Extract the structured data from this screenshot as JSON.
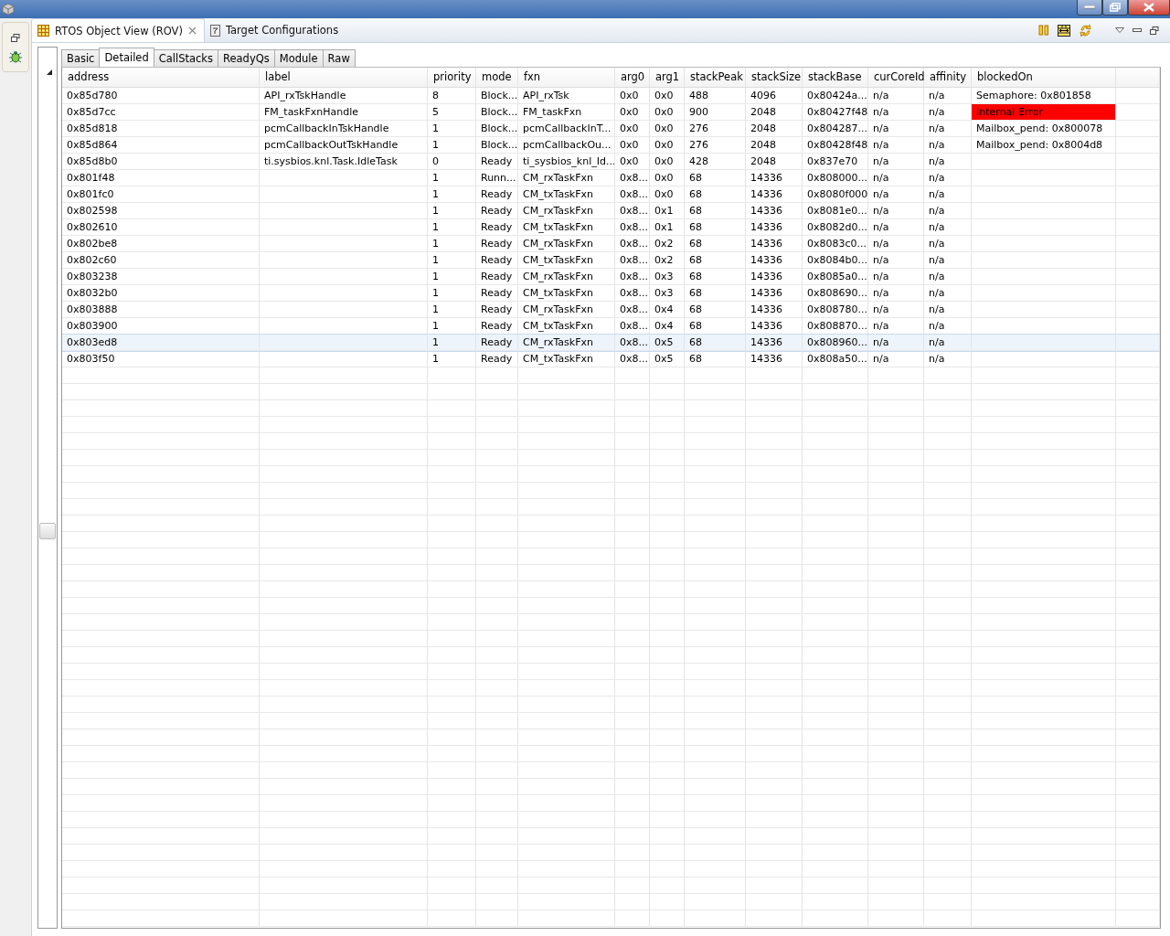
{
  "view_tabs": [
    {
      "label": "RTOS Object View (ROV)",
      "selected": true,
      "closable": true
    },
    {
      "label": "Target Configurations",
      "selected": false,
      "closable": false
    }
  ],
  "inner_tabs": [
    {
      "label": "Basic",
      "selected": false
    },
    {
      "label": "Detailed",
      "selected": true
    },
    {
      "label": "CallStacks",
      "selected": false
    },
    {
      "label": "ReadyQs",
      "selected": false
    },
    {
      "label": "Module",
      "selected": false
    },
    {
      "label": "Raw",
      "selected": false
    }
  ],
  "table": {
    "columns": [
      "address",
      "label",
      "priority",
      "mode",
      "fxn",
      "arg0",
      "arg1",
      "stackPeak",
      "stackSize",
      "stackBase",
      "curCoreId",
      "affinity",
      "blockedOn"
    ],
    "rows": [
      {
        "address": "0x85d780",
        "label": "API_rxTskHandle",
        "priority": "8",
        "mode": "Block...",
        "fxn": "API_rxTsk",
        "arg0": "0x0",
        "arg1": "0x0",
        "stackPeak": "488",
        "stackSize": "4096",
        "stackBase": "0x80424a...",
        "curCoreId": "n/a",
        "affinity": "n/a",
        "blockedOn": "Semaphore: 0x801858",
        "error": false,
        "selected": false
      },
      {
        "address": "0x85d7cc",
        "label": "FM_taskFxnHandle",
        "priority": "5",
        "mode": "Block...",
        "fxn": "FM_taskFxn",
        "arg0": "0x0",
        "arg1": "0x0",
        "stackPeak": "900",
        "stackSize": "2048",
        "stackBase": "0x80427f48",
        "curCoreId": "n/a",
        "affinity": "n/a",
        "blockedOn": "Internal Error",
        "error": true,
        "selected": false
      },
      {
        "address": "0x85d818",
        "label": "pcmCallbackInTskHandle",
        "priority": "1",
        "mode": "Block...",
        "fxn": "pcmCallbackInT...",
        "arg0": "0x0",
        "arg1": "0x0",
        "stackPeak": "276",
        "stackSize": "2048",
        "stackBase": "0x804287...",
        "curCoreId": "n/a",
        "affinity": "n/a",
        "blockedOn": "Mailbox_pend: 0x800078",
        "error": false,
        "selected": false
      },
      {
        "address": "0x85d864",
        "label": "pcmCallbackOutTskHandle",
        "priority": "1",
        "mode": "Block...",
        "fxn": "pcmCallbackOu...",
        "arg0": "0x0",
        "arg1": "0x0",
        "stackPeak": "276",
        "stackSize": "2048",
        "stackBase": "0x80428f48",
        "curCoreId": "n/a",
        "affinity": "n/a",
        "blockedOn": "Mailbox_pend: 0x8004d8",
        "error": false,
        "selected": false
      },
      {
        "address": "0x85d8b0",
        "label": "ti.sysbios.knl.Task.IdleTask",
        "priority": "0",
        "mode": "Ready",
        "fxn": "ti_sysbios_knl_Id...",
        "arg0": "0x0",
        "arg1": "0x0",
        "stackPeak": "428",
        "stackSize": "2048",
        "stackBase": "0x837e70",
        "curCoreId": "n/a",
        "affinity": "n/a",
        "selected": false
      },
      {
        "address": "0x801f48",
        "priority": "1",
        "mode": "Runn...",
        "fxn": "CM_rxTaskFxn",
        "arg0": "0x8...",
        "arg1": "0x0",
        "stackPeak": "68",
        "stackSize": "14336",
        "stackBase": "0x808000...",
        "curCoreId": "n/a",
        "affinity": "n/a",
        "selected": false
      },
      {
        "address": "0x801fc0",
        "priority": "1",
        "mode": "Ready",
        "fxn": "CM_txTaskFxn",
        "arg0": "0x8...",
        "arg1": "0x0",
        "stackPeak": "68",
        "stackSize": "14336",
        "stackBase": "0x8080f000",
        "curCoreId": "n/a",
        "affinity": "n/a",
        "selected": false
      },
      {
        "address": "0x802598",
        "priority": "1",
        "mode": "Ready",
        "fxn": "CM_rxTaskFxn",
        "arg0": "0x8...",
        "arg1": "0x1",
        "stackPeak": "68",
        "stackSize": "14336",
        "stackBase": "0x8081e0...",
        "curCoreId": "n/a",
        "affinity": "n/a",
        "selected": false
      },
      {
        "address": "0x802610",
        "priority": "1",
        "mode": "Ready",
        "fxn": "CM_txTaskFxn",
        "arg0": "0x8...",
        "arg1": "0x1",
        "stackPeak": "68",
        "stackSize": "14336",
        "stackBase": "0x8082d0...",
        "curCoreId": "n/a",
        "affinity": "n/a",
        "selected": false
      },
      {
        "address": "0x802be8",
        "priority": "1",
        "mode": "Ready",
        "fxn": "CM_rxTaskFxn",
        "arg0": "0x8...",
        "arg1": "0x2",
        "stackPeak": "68",
        "stackSize": "14336",
        "stackBase": "0x8083c0...",
        "curCoreId": "n/a",
        "affinity": "n/a",
        "selected": false
      },
      {
        "address": "0x802c60",
        "priority": "1",
        "mode": "Ready",
        "fxn": "CM_txTaskFxn",
        "arg0": "0x8...",
        "arg1": "0x2",
        "stackPeak": "68",
        "stackSize": "14336",
        "stackBase": "0x8084b0...",
        "curCoreId": "n/a",
        "affinity": "n/a",
        "selected": false
      },
      {
        "address": "0x803238",
        "priority": "1",
        "mode": "Ready",
        "fxn": "CM_rxTaskFxn",
        "arg0": "0x8...",
        "arg1": "0x3",
        "stackPeak": "68",
        "stackSize": "14336",
        "stackBase": "0x8085a0...",
        "curCoreId": "n/a",
        "affinity": "n/a",
        "selected": false
      },
      {
        "address": "0x8032b0",
        "priority": "1",
        "mode": "Ready",
        "fxn": "CM_txTaskFxn",
        "arg0": "0x8...",
        "arg1": "0x3",
        "stackPeak": "68",
        "stackSize": "14336",
        "stackBase": "0x808690...",
        "curCoreId": "n/a",
        "affinity": "n/a",
        "selected": false
      },
      {
        "address": "0x803888",
        "priority": "1",
        "mode": "Ready",
        "fxn": "CM_rxTaskFxn",
        "arg0": "0x8...",
        "arg1": "0x4",
        "stackPeak": "68",
        "stackSize": "14336",
        "stackBase": "0x808780...",
        "curCoreId": "n/a",
        "affinity": "n/a",
        "selected": false
      },
      {
        "address": "0x803900",
        "priority": "1",
        "mode": "Ready",
        "fxn": "CM_txTaskFxn",
        "arg0": "0x8...",
        "arg1": "0x4",
        "stackPeak": "68",
        "stackSize": "14336",
        "stackBase": "0x808870...",
        "curCoreId": "n/a",
        "affinity": "n/a",
        "selected": false
      },
      {
        "address": "0x803ed8",
        "priority": "1",
        "mode": "Ready",
        "fxn": "CM_rxTaskFxn",
        "arg0": "0x8...",
        "arg1": "0x5",
        "stackPeak": "68",
        "stackSize": "14336",
        "stackBase": "0x808960...",
        "curCoreId": "n/a",
        "affinity": "n/a",
        "selected": true
      },
      {
        "address": "0x803f50",
        "priority": "1",
        "mode": "Ready",
        "fxn": "CM_txTaskFxn",
        "arg0": "0x8...",
        "arg1": "0x5",
        "stackPeak": "68",
        "stackSize": "14336",
        "stackBase": "0x808a50...",
        "curCoreId": "n/a",
        "affinity": "n/a",
        "selected": false
      }
    ]
  }
}
